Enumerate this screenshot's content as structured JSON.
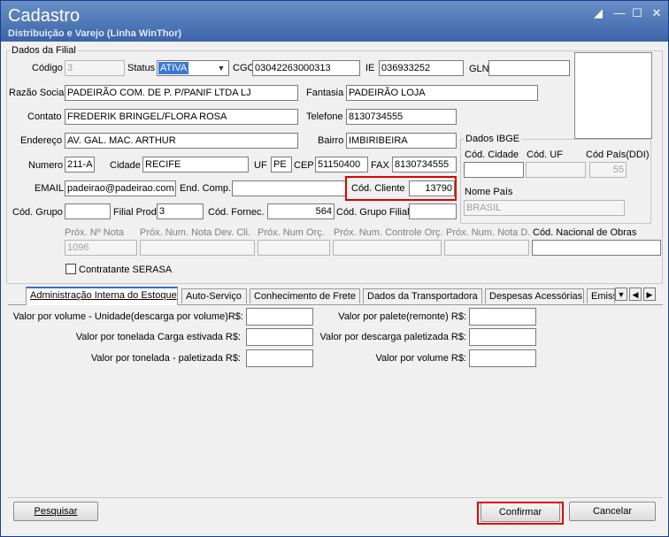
{
  "window": {
    "title": "Cadastro",
    "subtitle": "Distribuição e Varejo (Linha WinThor)"
  },
  "filial_group": {
    "title": "Dados da Filial"
  },
  "fields": {
    "codigo": {
      "label": "Código",
      "value": "3"
    },
    "status": {
      "label": "Status",
      "value": "ATIVA"
    },
    "cgc": {
      "label": "CGC",
      "value": "03042263000313"
    },
    "ie": {
      "label": "IE",
      "value": "036933252"
    },
    "gln": {
      "label": "GLN",
      "value": ""
    },
    "razao_social": {
      "label": "Razão Social",
      "value": "PADEIRÃO COM. DE P. P/PANIF LTDA LJ"
    },
    "fantasia": {
      "label": "Fantasia",
      "value": "PADEIRÃO LOJA"
    },
    "contato": {
      "label": "Contato",
      "value": "FREDERIK BRINGEL/FLORA ROSA"
    },
    "telefone": {
      "label": "Telefone",
      "value": "8130734555"
    },
    "endereco": {
      "label": "Endereço",
      "value": "AV. GAL. MAC. ARTHUR"
    },
    "bairro": {
      "label": "Bairro",
      "value": "IMBIRIBEIRA"
    },
    "numero": {
      "label": "Numero",
      "value": "211-A"
    },
    "cidade": {
      "label": "Cidade",
      "value": "RECIFE"
    },
    "uf": {
      "label": "UF",
      "value": "PE"
    },
    "cep": {
      "label": "CEP",
      "value": "51150400"
    },
    "fax": {
      "label": "FAX",
      "value": "8130734555"
    },
    "email": {
      "label": "EMAIL",
      "value": "padeirao@padeirao.com"
    },
    "end_comp": {
      "label": "End. Comp.",
      "value": ""
    },
    "cod_cliente": {
      "label": "Cód. Cliente",
      "value": "13790"
    },
    "cod_grupo": {
      "label": "Cód. Grupo",
      "value": ""
    },
    "filial_prod": {
      "label": "Filial Prod.",
      "value": "3"
    },
    "cod_fornec": {
      "label": "Cód. Fornec.",
      "value": "564"
    },
    "cod_grupo_filial": {
      "label": "Cód. Grupo Filial",
      "value": ""
    },
    "prox_nota": {
      "label": "Próx. Nº Nota",
      "value": "1096"
    },
    "prox_nota_dev": {
      "label": "Próx. Num. Nota Dev. Cli.",
      "value": ""
    },
    "prox_orc": {
      "label": "Próx. Num Orç.",
      "value": ""
    },
    "prox_controle_orc": {
      "label": "Próx. Num. Controle Orç.",
      "value": ""
    },
    "prox_nota_d": {
      "label": "Próx. Num. Nota D.",
      "value": ""
    },
    "cod_nac_obras": {
      "label": "Cód. Nacional de Obras",
      "value": ""
    },
    "contratante_serasa": {
      "label": "Contratante SERASA"
    }
  },
  "ibge": {
    "title": "Dados IBGE",
    "cod_cidade": {
      "label": "Cód. Cidade",
      "value": ""
    },
    "cod_uf": {
      "label": "Cód. UF",
      "value": ""
    },
    "cod_pais": {
      "label": "Cód País(DDI)",
      "value": "55"
    },
    "nome_pais": {
      "label": "Nome País",
      "value": "BRASIL"
    }
  },
  "tabs": [
    {
      "label": "Administração Interna do Estoque"
    },
    {
      "label": "Auto-Serviço"
    },
    {
      "label": "Conhecimento de Frete"
    },
    {
      "label": "Dados da Transportadora"
    },
    {
      "label": "Despesas Acessórias"
    },
    {
      "label": "Emiss"
    }
  ],
  "tab_content": {
    "valor_volume_unidade": {
      "label": "Valor por volume - Unidade(descarga por volume)R$:",
      "value": ""
    },
    "valor_tonelada_estivada": {
      "label": "Valor por tonelada Carga estivada R$:",
      "value": ""
    },
    "valor_tonelada_paletizada": {
      "label": "Valor por tonelada - paletizada R$:",
      "value": ""
    },
    "valor_palete": {
      "label": "Valor por palete(remonte) R$:",
      "value": ""
    },
    "valor_descarga_paletizada": {
      "label": "Valor por descarga paletizada R$:",
      "value": ""
    },
    "valor_volume": {
      "label": "Valor por volume R$:",
      "value": ""
    }
  },
  "buttons": {
    "pesquisar": "Pesquisar",
    "confirmar": "Confirmar",
    "cancelar": "Cancelar"
  },
  "colors": {
    "highlight": "#e00000",
    "titlebar": "#4a72b4",
    "selection": "#3a78d6"
  }
}
